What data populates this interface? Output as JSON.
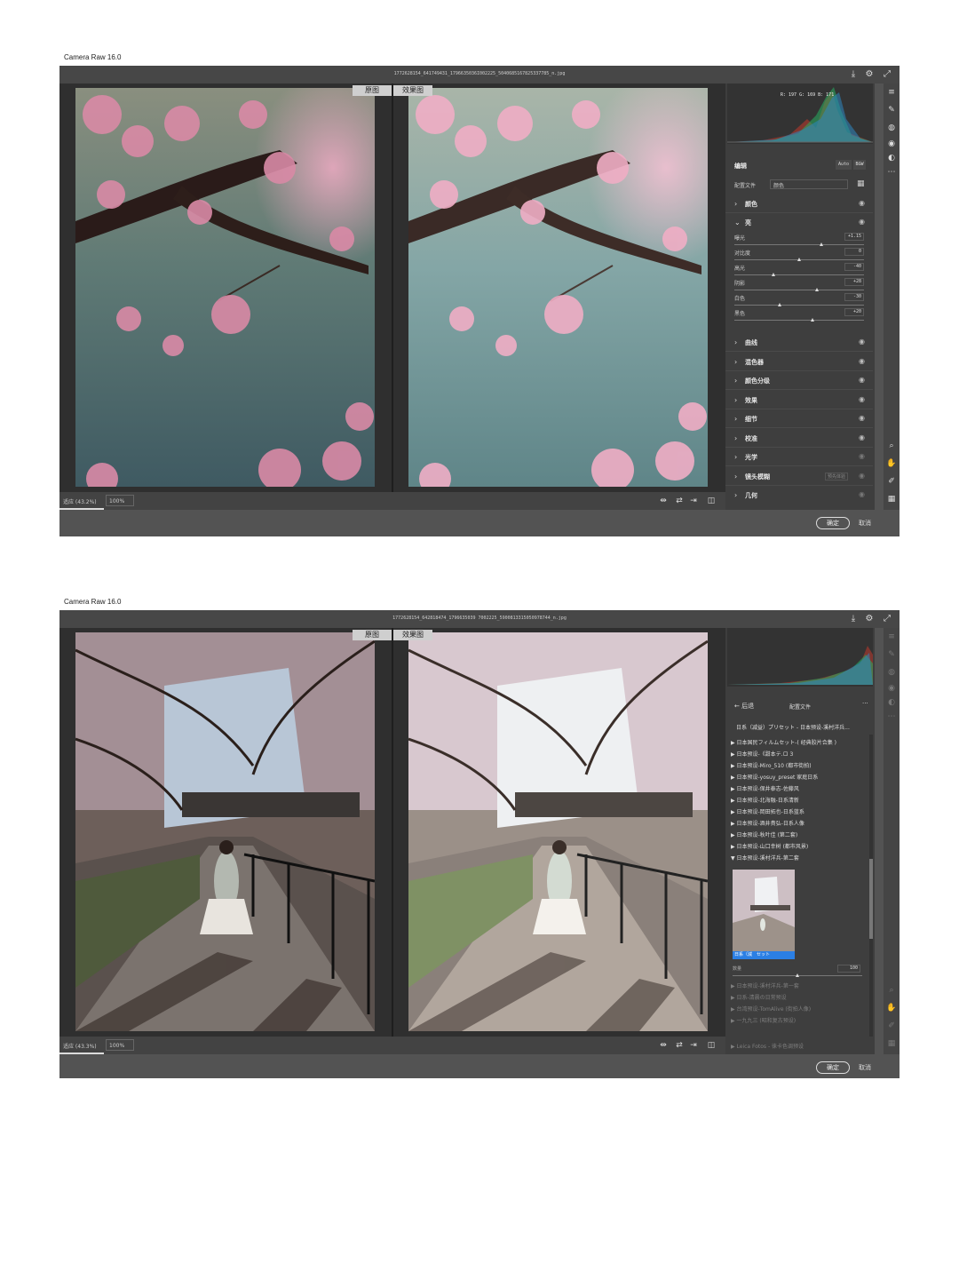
{
  "windows": [
    {
      "caption": "Camera Raw 16.0",
      "filename": "1772628154_641749431_1796635036I002225_5040685167825337785_n.jpg",
      "compare": {
        "before": "原图",
        "after": "效果图"
      },
      "status": {
        "fit": "适应 (43.2%)",
        "zoom": "100%"
      },
      "histogram": {
        "readout": "R: 197   G: 169   B: 171"
      },
      "edit": {
        "title": "编辑",
        "auto": "Auto",
        "bw": "B&W",
        "profile_label": "配置文件",
        "profile_value": "颜色",
        "sections": [
          {
            "name": "颜色",
            "expanded": false
          },
          {
            "name": "亮",
            "expanded": true
          },
          {
            "name": "曲线",
            "expanded": false
          },
          {
            "name": "混色器",
            "expanded": false
          },
          {
            "name": "颜色分级",
            "expanded": false
          },
          {
            "name": "效果",
            "expanded": false
          },
          {
            "name": "细节",
            "expanded": false
          },
          {
            "name": "校准",
            "expanded": false
          },
          {
            "name": "光学",
            "expanded": false
          },
          {
            "name": "镜头模糊",
            "expanded": false,
            "tag": "预先体验"
          },
          {
            "name": "几何",
            "expanded": false
          }
        ],
        "light_sliders": [
          {
            "label": "曝光",
            "value": "+1.15",
            "level": 0.67
          },
          {
            "label": "对比度",
            "value": "0",
            "level": 0.5
          },
          {
            "label": "高光",
            "value": "-40",
            "level": 0.3
          },
          {
            "label": "阴影",
            "value": "+28",
            "level": 0.64
          },
          {
            "label": "白色",
            "value": "-30",
            "level": 0.35
          },
          {
            "label": "黑色",
            "value": "+20",
            "level": 0.6
          }
        ]
      },
      "buttons": {
        "ok": "确定",
        "cancel": "取消"
      }
    },
    {
      "caption": "Camera Raw 16.0",
      "filename": "1772628154_642818474_1796635039 7002225_5900813315050978744_n.jpg",
      "compare": {
        "before": "原图",
        "after": "效果图"
      },
      "status": {
        "fit": "适应 (43.3%)",
        "zoom": "100%"
      },
      "presets": {
        "back": "后退",
        "title": "配置文件",
        "more": "···",
        "current": "日系（减益）プリセット - 日本预设-溪村洋兵...",
        "groups": [
          "▶ 日本国民フィルムセット-( 经典胶片合集 )",
          "▶ 日本预设-《甜本テ.ロ 3",
          "▶ 日本预设-Miro_510 (都市街拍)",
          "▶ 日本预设-yosuy_preset 家庭日系",
          "▶ 日本预设-保井泰志-佐藤风",
          "▶ 日本预设-北海融-日系清新",
          "▶ 日本预设-岡田拓也-日系蓝系",
          "▶ 日本预设-酒井貴弘-日系人像",
          "▶ 日本预设-秋叶佳 (第二套)",
          "▶ 日本预设-山口幸树 (都市风景)",
          "▼ 日本预设-溪村洋兵-第二套"
        ],
        "selected_preset": "日系（減　セット",
        "amount_label": "数量",
        "amount_value": "100",
        "amount_level": 0.5,
        "after_groups": [
          "▶ 日本预设-溪村洋兵-第一套",
          "▶ 日系-清晨の日常预设",
          "▶ 台湾预设-TomAlive (街拍人像)",
          "▶ 一九九三 (昭和复古预设)"
        ],
        "footer": "▶ Leica Fotos - 徕卡色调预设"
      },
      "buttons": {
        "ok": "确定",
        "cancel": "取消"
      }
    }
  ]
}
